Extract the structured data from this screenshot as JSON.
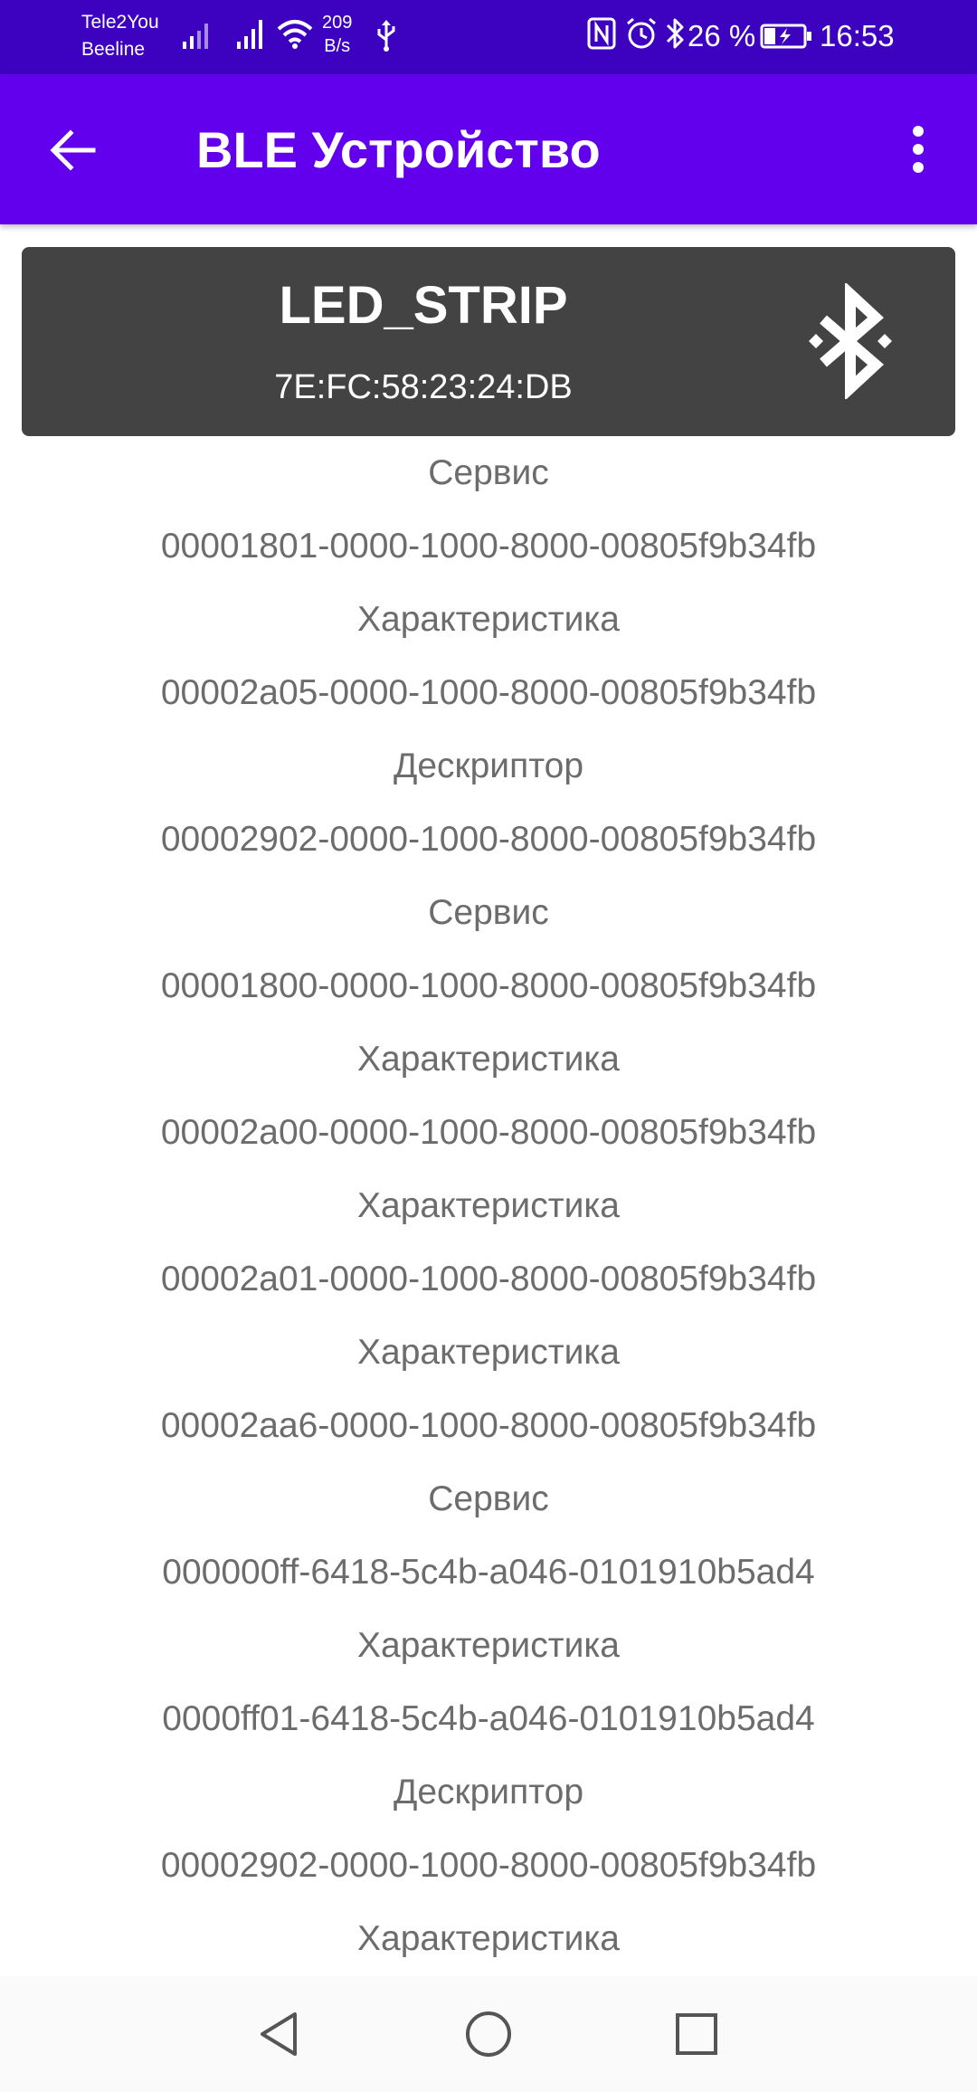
{
  "status_bar": {
    "carrier_1": "Tele2You",
    "carrier_2": "Beeline",
    "net_speed_value": "209",
    "net_speed_unit": "B/s",
    "battery_percent": "26 %",
    "time": "16:53",
    "icons": [
      "signal-icon",
      "signal-icon",
      "wifi-icon",
      "usb-icon",
      "nfc-icon",
      "alarm-icon",
      "bluetooth-icon",
      "battery-charging-icon"
    ]
  },
  "app_bar": {
    "title": "BLE Устройство",
    "back_icon": "arrow-back-icon",
    "menu_icon": "more-vert-icon"
  },
  "device": {
    "name": "LED_STRIP",
    "address": "7E:FC:58:23:24:DB",
    "icon": "bluetooth-icon"
  },
  "gatt_list": [
    "Сервис",
    "00001801-0000-1000-8000-00805f9b34fb",
    "Характеристика",
    "00002a05-0000-1000-8000-00805f9b34fb",
    "Дескриптор",
    "00002902-0000-1000-8000-00805f9b34fb",
    "Сервис",
    "00001800-0000-1000-8000-00805f9b34fb",
    "Характеристика",
    "00002a00-0000-1000-8000-00805f9b34fb",
    "Характеристика",
    "00002a01-0000-1000-8000-00805f9b34fb",
    "Характеристика",
    "00002aa6-0000-1000-8000-00805f9b34fb",
    "Сервис",
    "000000ff-6418-5c4b-a046-0101910b5ad4",
    "Характеристика",
    "0000ff01-6418-5c4b-a046-0101910b5ad4",
    "Дескриптор",
    "00002902-0000-1000-8000-00805f9b34fb",
    "Характеристика"
  ],
  "nav_bar": {
    "buttons": [
      "nav-back-icon",
      "nav-home-icon",
      "nav-recents-icon"
    ]
  },
  "colors": {
    "status_bar": "#3d02c0",
    "app_bar": "#6200ee",
    "card": "#434343",
    "list_text": "#6c6c6c"
  }
}
